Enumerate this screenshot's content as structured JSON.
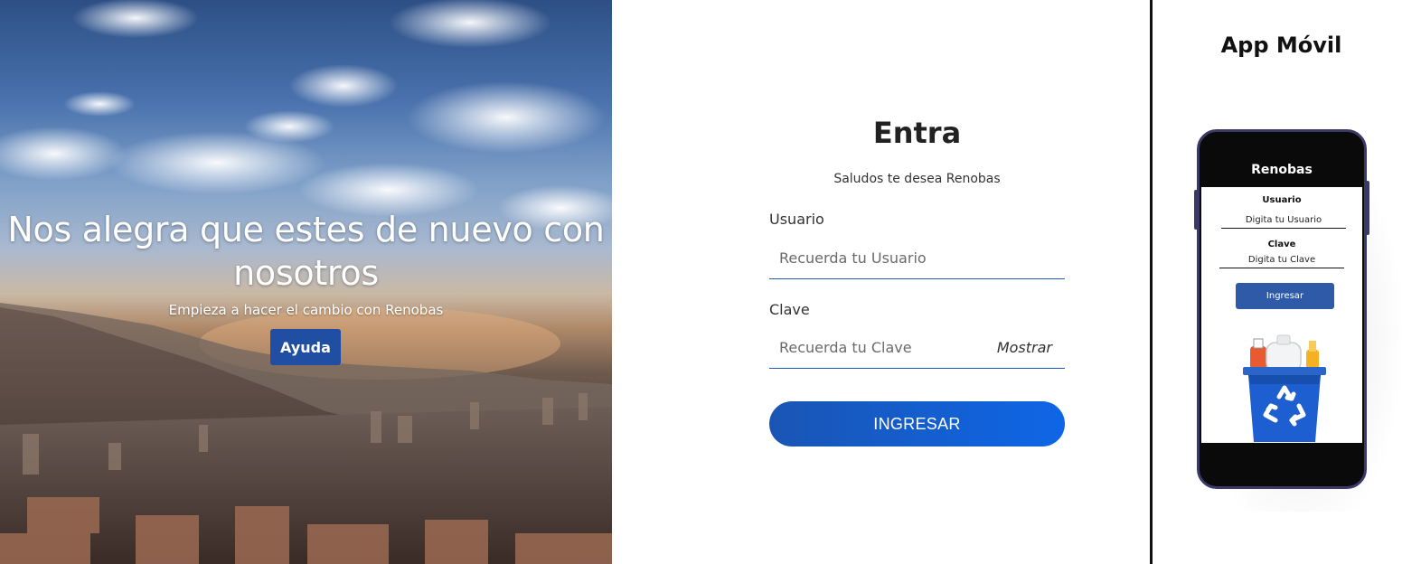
{
  "hero": {
    "title": "Nos alegra que estes de nuevo con nosotros",
    "subtitle": "Empieza a hacer el cambio con Renobas",
    "help_label": "Ayuda"
  },
  "login": {
    "title": "Entra",
    "subtitle": "Saludos te desea Renobas",
    "user_label": "Usuario",
    "user_placeholder": "Recuerda tu Usuario",
    "password_label": "Clave",
    "password_placeholder": "Recuerda tu Clave",
    "show_label": "Mostrar",
    "submit_label": "INGRESAR"
  },
  "mobile": {
    "section_title": "App Móvil",
    "app_name": "Renobas",
    "user_label": "Usuario",
    "user_placeholder": "Digita tu Usuario",
    "password_label": "Clave",
    "password_placeholder": "Digita tu Clave",
    "submit_label": "Ingresar"
  },
  "colors": {
    "primary": "#1f4ea3",
    "accent": "#0e66e6",
    "divider": "#111111",
    "phone_frame": "#3b3a66"
  },
  "icons": [
    "recycle-bin-icon",
    "recycle-symbol-icon"
  ]
}
